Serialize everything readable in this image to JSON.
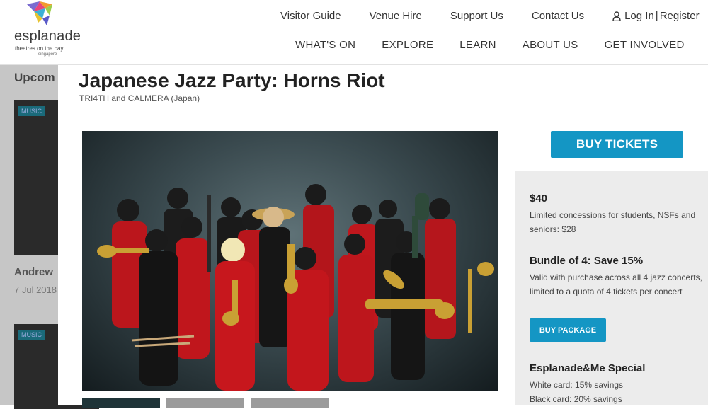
{
  "brand": {
    "name": "esplanade",
    "tagline": "theatres on the bay",
    "location": "singapore"
  },
  "utility_nav": [
    "Visitor Guide",
    "Venue Hire",
    "Support Us",
    "Contact Us"
  ],
  "auth": {
    "login": "Log In",
    "separator": "|",
    "register": "Register"
  },
  "main_nav": [
    "WHAT'S ON",
    "EXPLORE",
    "LEARN",
    "ABOUT US",
    "GET INVOLVED"
  ],
  "background_page": {
    "section_title": "Upcom",
    "card_tag": "MUSIC",
    "card_name": "Andrew",
    "card_date": "7 Jul 2018"
  },
  "event": {
    "title": "Japanese Jazz Party: Horns Riot",
    "subtitle": "TRI4TH and CALMERA (Japan)",
    "buy_label": "BUY TICKETS"
  },
  "pricing": {
    "standard": {
      "price": "$40",
      "note": "Limited concessions for students, NSFs and seniors: $28"
    },
    "bundle": {
      "title": "Bundle of 4: Save 15%",
      "note": "Valid with purchase across all 4 jazz concerts, limited to a quota of 4 tickets per concert",
      "button": "BUY PACKAGE"
    },
    "special": {
      "title": "Esplanade&Me Special",
      "lines": [
        "White card: 15% savings",
        "Black card: 20% savings"
      ]
    }
  },
  "colors": {
    "accent": "#1496c4",
    "panel": "#ececec",
    "suit": "#c4161c"
  },
  "icons": {
    "user": "user-icon"
  }
}
